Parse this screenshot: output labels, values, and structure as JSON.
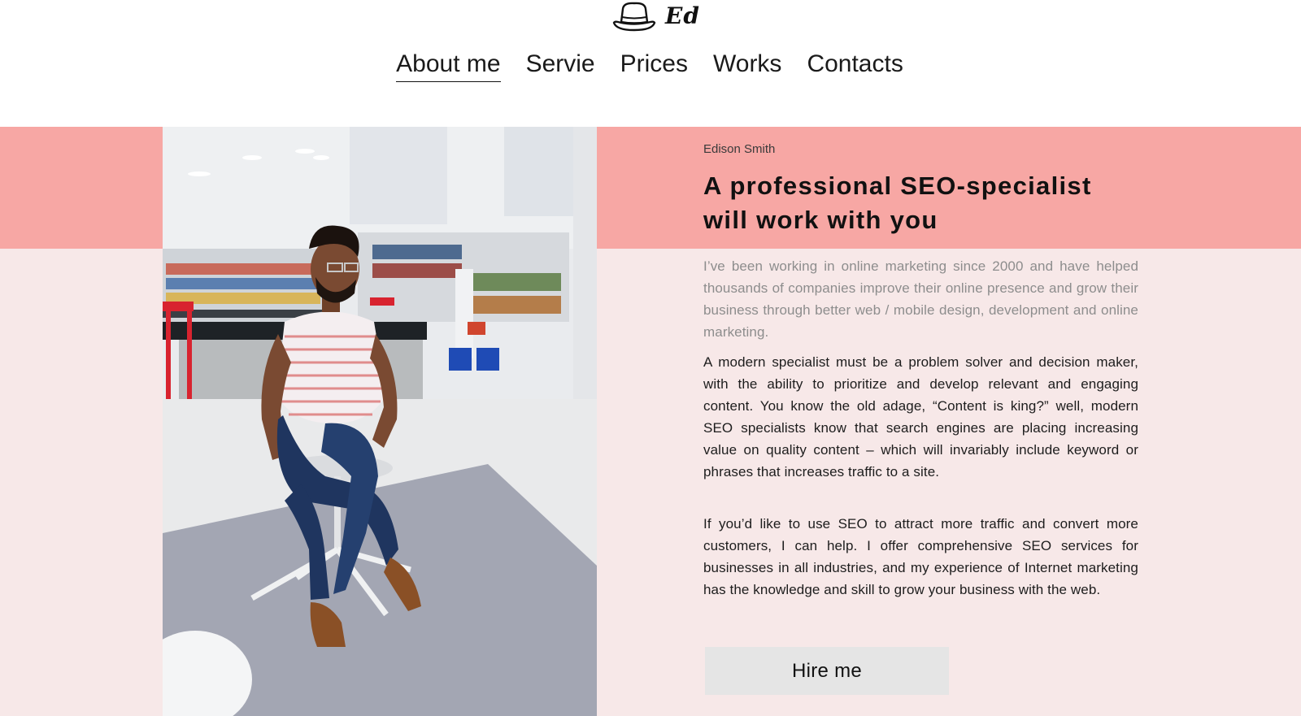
{
  "brand": {
    "logo_text": "Ed",
    "logo_icon": "hat-icon"
  },
  "nav": {
    "items": [
      {
        "label": "About me",
        "active": true
      },
      {
        "label": "Servie",
        "active": false
      },
      {
        "label": "Prices",
        "active": false
      },
      {
        "label": "Works",
        "active": false
      },
      {
        "label": "Contacts",
        "active": false
      }
    ]
  },
  "hero": {
    "author": "Edison Smith",
    "headline_line1": "A professional SEO-specialist",
    "headline_line2": "will work with you",
    "intro": "I’ve been working in online marketing since 2000 and have helped thousands of companies improve their online presence and grow their business through better web / mobile design, development and online marketing.",
    "paragraph1": "A modern specialist must be a problem solver and decision maker, with the ability to prioritize and develop relevant and engaging content. You know the old adage, “Content is king?” well, modern SEO specialists know that search engines are placing increasing value on quality content – which will invariably include keyword or phrases that increases traffic to a site.",
    "paragraph2": "If you’d like to use SEO to attract more traffic and convert more customers, I can help. I offer comprehensive SEO services for businesses in all industries, and my experience of Internet marketing has the knowledge and skill to grow your business with the web.",
    "cta_label": "Hire me",
    "photo_subject": "portrait-photo"
  },
  "colors": {
    "band_top": "#f7a7a4",
    "band_bottom": "#f7e8e8",
    "button_bg": "#e5e5e5"
  }
}
